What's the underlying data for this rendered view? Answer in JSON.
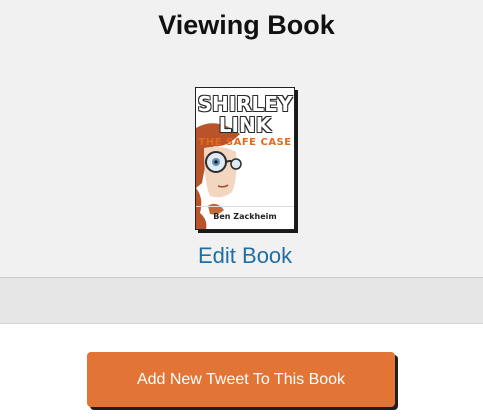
{
  "header": {
    "title": "Viewing Book"
  },
  "book": {
    "cover": {
      "title_line1": "SHIRLEY",
      "title_line2": "LINK",
      "subtitle": "THE SAFE CASE",
      "author": "Ben Zackheim"
    },
    "edit_label": "Edit Book"
  },
  "actions": {
    "add_tweet_label": "Add New Tweet To This Book"
  },
  "colors": {
    "accent_button": "#e27535",
    "link": "#1e6fa6",
    "panel_background": "#f1f1f1"
  }
}
